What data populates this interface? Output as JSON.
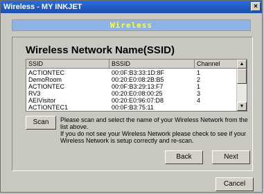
{
  "window": {
    "title": "Wireless - MY INKJET",
    "close_glyph": "×"
  },
  "banner": {
    "text": "Wireless"
  },
  "panel": {
    "title": "Wireless Network Name(SSID)"
  },
  "list": {
    "headers": [
      "SSID",
      "BSSID",
      "Channel"
    ],
    "rows": [
      {
        "ssid": "ACTIONTEC",
        "bssid": "00:0F:B3:33:1D:8F",
        "channel": "1"
      },
      {
        "ssid": "DemoRoom",
        "bssid": "00:20:E0:08:2B:B5",
        "channel": "2"
      },
      {
        "ssid": "ACTIONTEC",
        "bssid": "00:0F:B3:29:13:F7",
        "channel": "1"
      },
      {
        "ssid": "RV3",
        "bssid": "00:20:E0:08:00:25",
        "channel": "3"
      },
      {
        "ssid": "AEIVisitor",
        "bssid": "00:20:E0:96:07:D8",
        "channel": "4"
      },
      {
        "ssid": "ACTIONTEC1",
        "bssid": "00:0F:B3:75:11",
        "channel": ""
      }
    ],
    "scroll_up_glyph": "▲",
    "scroll_down_glyph": "▼"
  },
  "buttons": {
    "scan": "Scan",
    "back": "Back",
    "next": "Next",
    "cancel": "Cancel"
  },
  "message": {
    "line1": "Please scan and select the name of your Wireless Network from the list above.",
    "line2": "If you do not see your Wireless Network please check to see if your Wireless Network is setup correctly and re-scan."
  }
}
